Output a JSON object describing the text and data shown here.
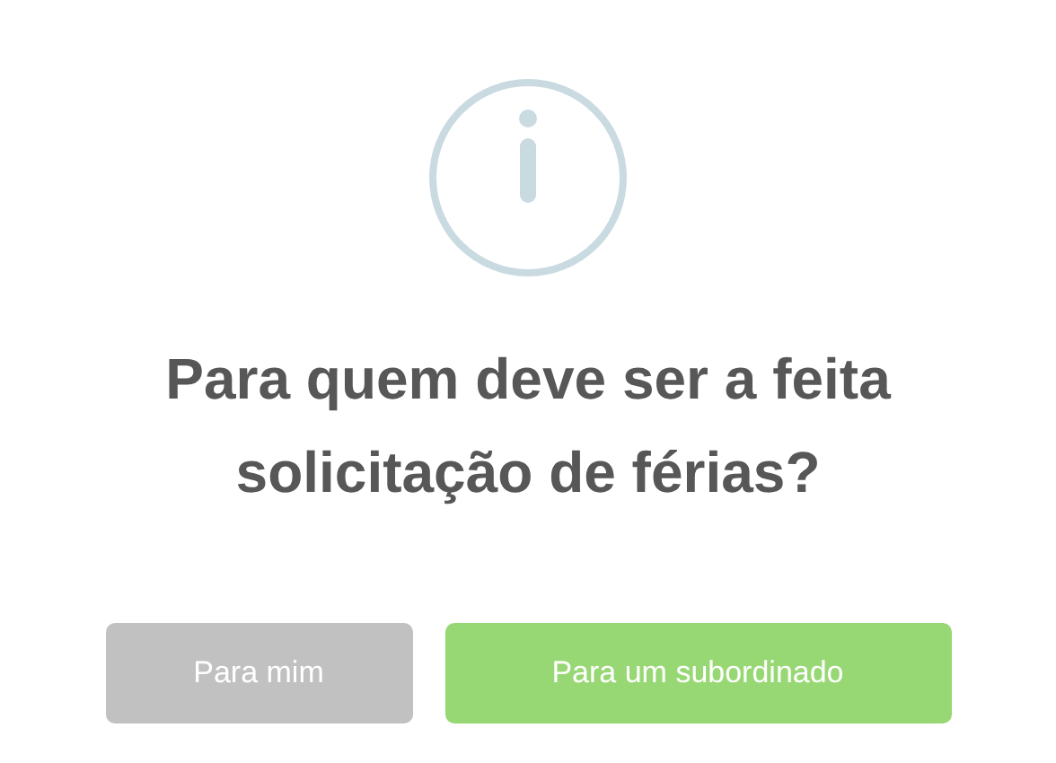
{
  "dialog": {
    "kind": "info",
    "title": "Para quem deve ser a feita solicitação de férias?",
    "buttons": [
      {
        "label": "Para mim",
        "kind": "cancel"
      },
      {
        "label": "Para um subordinado",
        "kind": "confirm"
      }
    ]
  }
}
